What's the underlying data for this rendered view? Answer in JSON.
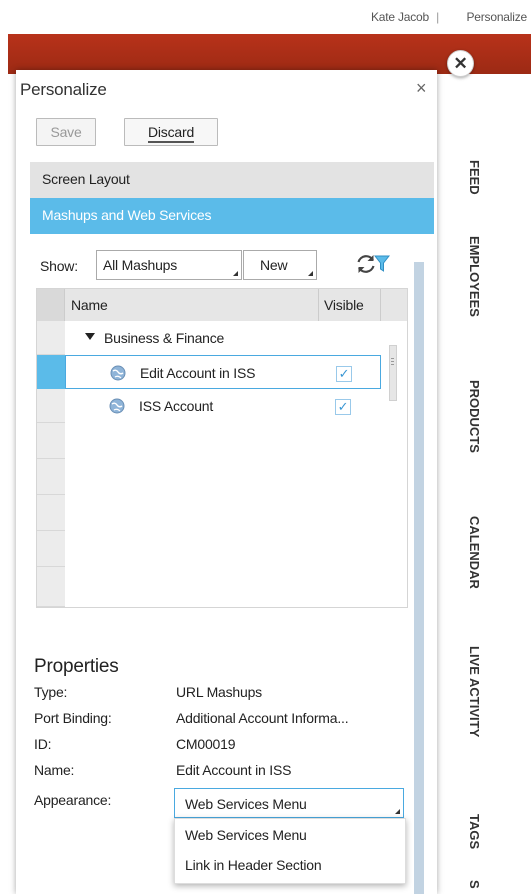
{
  "topbar": {
    "user_name": "Kate Jacob",
    "separator": "|",
    "personalize_link": "Personalize"
  },
  "panel": {
    "title": "Personalize",
    "close_glyph": "×",
    "save_label": "Save",
    "discard_label": "Discard"
  },
  "sections": {
    "screen_layout": "Screen Layout",
    "mashups": "Mashups and Web Services"
  },
  "toolbar": {
    "show_label": "Show:",
    "show_value": "All Mashups",
    "new_label": "New"
  },
  "table": {
    "col_name": "Name",
    "col_visible": "Visible",
    "group_label": "Business & Finance",
    "rows": [
      {
        "label": "Edit Account in ISS",
        "visible": true,
        "check": "✓"
      },
      {
        "label": "ISS Account",
        "visible": true,
        "check": "✓"
      }
    ]
  },
  "properties": {
    "title": "Properties",
    "type_label": "Type:",
    "type_value": "URL Mashups",
    "port_label": "Port Binding:",
    "port_value": "Additional Account Informa...",
    "id_label": "ID:",
    "id_value": "CM00019",
    "name_label": "Name:",
    "name_value": "Edit Account in ISS",
    "appearance_label": "Appearance:",
    "appearance_value": "Web Services Menu",
    "appearance_options": [
      "Web Services Menu",
      "Link in Header Section"
    ]
  },
  "side_tabs": [
    "FEED",
    "EMPLOYEES",
    "PRODUCTS",
    "CALENDAR",
    "LIVE ACTIVITY",
    "TAGS",
    "S"
  ],
  "close_overlay_glyph": "✕",
  "colors": {
    "accent": "#5bbbe9",
    "header_red": "#b8321a",
    "selection_border": "#4aa9e0"
  },
  "icons": [
    "refresh-icon",
    "filter-icon",
    "globe-icon",
    "close-icon",
    "caret-down-icon"
  ]
}
